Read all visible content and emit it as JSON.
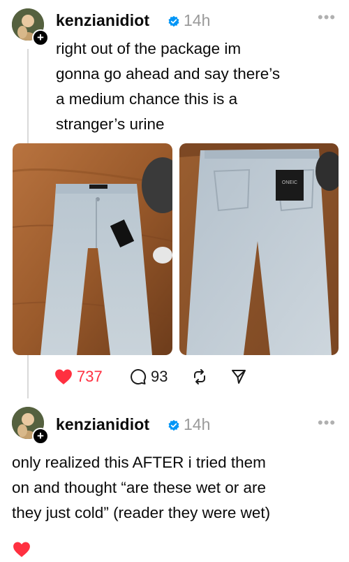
{
  "posts": [
    {
      "username": "kenzianidiot",
      "timestamp": "14h",
      "text": "right out of the package im\ngonna go ahead and say there’s\na medium chance this is a\nstranger’s urine",
      "images": [
        {
          "description": "light wash jeans with black hang tag laid flat on wooden table"
        },
        {
          "description": "back view of light wash jeans with black brand patch on wooden floor"
        }
      ],
      "likes": "737",
      "replies": "93",
      "brand_patch_text": "ONEIC"
    },
    {
      "username": "kenzianidiot",
      "timestamp": "14h",
      "text": "only realized this AFTER i tried them\non and thought “are these wet or are\nthey just cold” (reader they were wet)"
    }
  ],
  "icons": {
    "avatar_badge": "plus-icon",
    "verified": "verified-badge-icon",
    "more": "more-options-icon",
    "like": "heart-filled-icon",
    "reply": "comment-icon",
    "repost": "repost-icon",
    "share": "send-icon"
  },
  "colors": {
    "like_red": "#ff3040",
    "verified_blue": "#0095f6",
    "muted_gray": "#9a9a9a"
  }
}
